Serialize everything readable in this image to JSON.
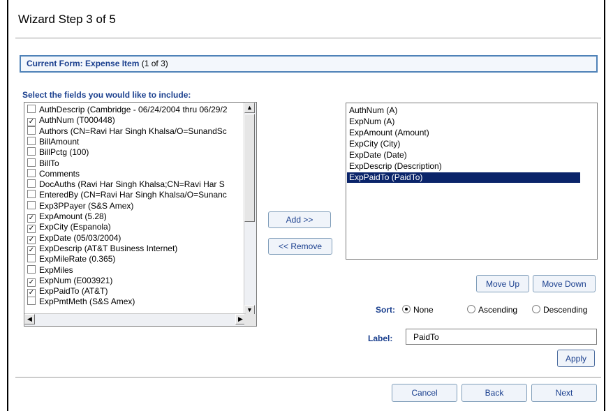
{
  "wizard": {
    "title": "Wizard Step 3 of 5"
  },
  "form_banner": {
    "label": "Current Form:",
    "form_name": "Expense Item",
    "count": "(1 of 3)"
  },
  "fields": {
    "label": "Select the fields you would like to include:",
    "items": [
      {
        "text": "AuthDescrip (Cambridge - 06/24/2004 thru 06/29/2",
        "checked": false
      },
      {
        "text": "AuthNum (T000448)",
        "checked": true
      },
      {
        "text": "Authors (CN=Ravi Har Singh Khalsa/O=SunandSc",
        "checked": false
      },
      {
        "text": "BillAmount",
        "checked": false
      },
      {
        "text": "BillPctg (100)",
        "checked": false
      },
      {
        "text": "BillTo",
        "checked": false
      },
      {
        "text": "Comments",
        "checked": false
      },
      {
        "text": "DocAuths (Ravi Har Singh Khalsa;CN=Ravi Har S",
        "checked": false
      },
      {
        "text": "EnteredBy (CN=Ravi Har Singh Khalsa/O=Sunanc",
        "checked": false
      },
      {
        "text": "Exp3PPayer (S&S Amex)",
        "checked": false
      },
      {
        "text": "ExpAmount (5.28)",
        "checked": true
      },
      {
        "text": "ExpCity (Espanola)",
        "checked": true
      },
      {
        "text": "ExpDate (05/03/2004)",
        "checked": true
      },
      {
        "text": "ExpDescrip (AT&T Business Internet)",
        "checked": true
      },
      {
        "text": "ExpMileRate (0.365)",
        "checked": false
      },
      {
        "text": "ExpMiles",
        "checked": false
      },
      {
        "text": "ExpNum (E003921)",
        "checked": true
      },
      {
        "text": "ExpPaidTo (AT&T)",
        "checked": true
      },
      {
        "text": "ExpPmtMeth (S&S Amex)",
        "checked": false
      }
    ]
  },
  "buttons": {
    "add": "Add >>",
    "remove": "<< Remove",
    "move_up": "Move Up",
    "move_down": "Move Down",
    "apply": "Apply",
    "cancel": "Cancel",
    "back": "Back",
    "next": "Next"
  },
  "selected_fields": {
    "items": [
      "AuthNum (A)",
      "ExpNum (A)",
      "ExpAmount (Amount)",
      "ExpCity (City)",
      "ExpDate (Date)",
      "ExpDescrip (Description)",
      "ExpPaidTo (PaidTo)"
    ],
    "active_index": 6
  },
  "sort": {
    "label": "Sort:",
    "options": [
      "None",
      "Ascending",
      "Descending"
    ],
    "selected": "None"
  },
  "label_field": {
    "label": "Label:",
    "value": "PaidTo"
  },
  "colors": {
    "accent": "#1a3f8e",
    "banner_border": "#4f82b8",
    "selection": "#0a246a"
  }
}
